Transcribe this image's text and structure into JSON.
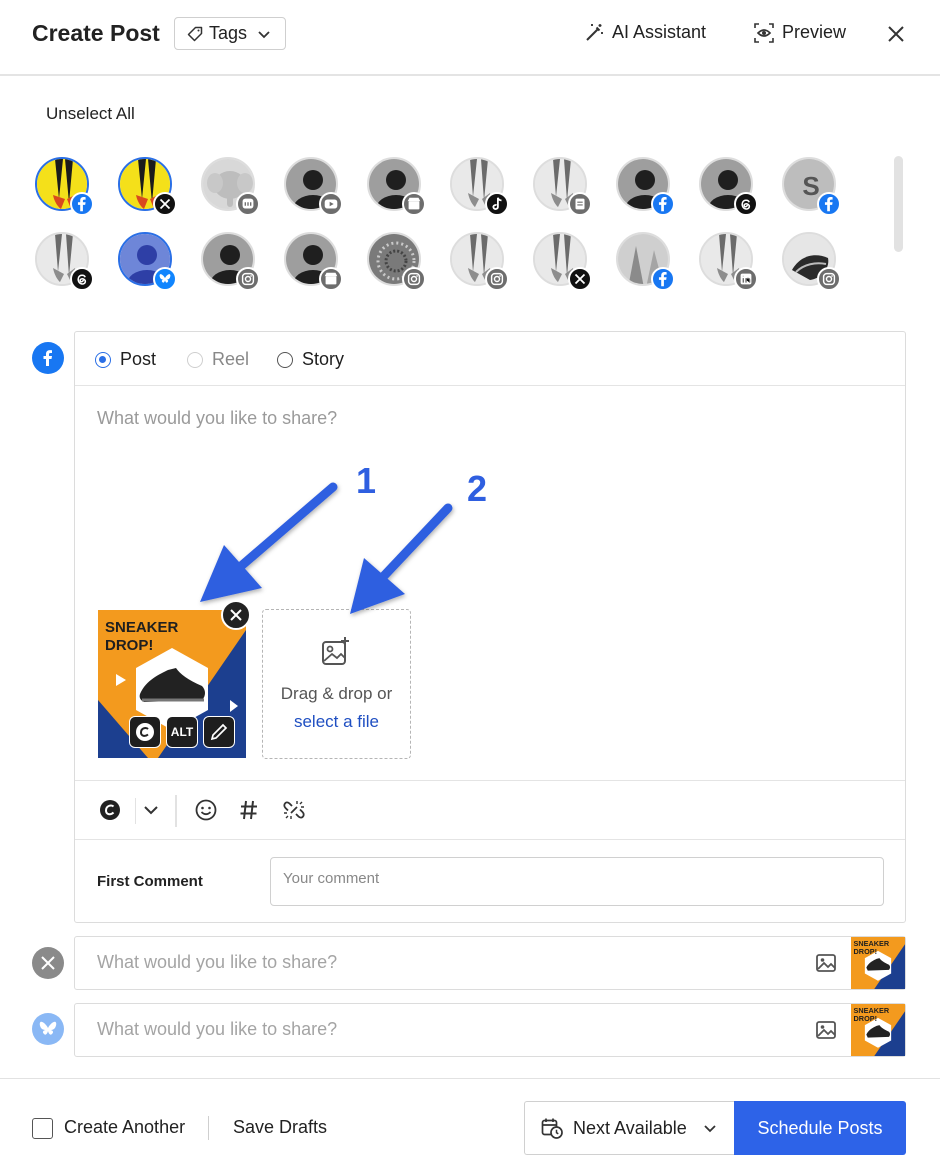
{
  "header": {
    "title": "Create Post",
    "tags_label": "Tags",
    "ai_label": "AI Assistant",
    "preview_label": "Preview"
  },
  "accounts": {
    "unselect_label": "Unselect All",
    "letter_avatar": "S",
    "items": [
      {
        "network": "facebook",
        "selected": true
      },
      {
        "network": "x",
        "selected": true
      },
      {
        "network": "mastodon",
        "selected": false
      },
      {
        "network": "youtube",
        "selected": false
      },
      {
        "network": "google-business",
        "selected": false
      },
      {
        "network": "tiktok",
        "selected": false
      },
      {
        "network": "other",
        "selected": false
      },
      {
        "network": "facebook",
        "selected": false
      },
      {
        "network": "threads",
        "selected": false
      },
      {
        "network": "facebook",
        "selected": false
      },
      {
        "network": "threads",
        "selected": false
      },
      {
        "network": "bluesky",
        "selected": true
      },
      {
        "network": "instagram",
        "selected": false
      },
      {
        "network": "google-business",
        "selected": false
      },
      {
        "network": "instagram",
        "selected": false
      },
      {
        "network": "instagram",
        "selected": false
      },
      {
        "network": "x",
        "selected": false
      },
      {
        "network": "facebook",
        "selected": false
      },
      {
        "network": "linkedin",
        "selected": false
      },
      {
        "network": "instagram",
        "selected": false
      }
    ]
  },
  "composer": {
    "types": [
      {
        "label": "Post",
        "checked": true
      },
      {
        "label": "Reel",
        "checked": false
      },
      {
        "label": "Story",
        "checked": false
      }
    ],
    "placeholder": "What would you like to share?",
    "media_text": "SNEAKER DROP!",
    "alt_label": "ALT",
    "drop_text": "Drag & drop or",
    "drop_link": "select a file",
    "first_comment_label": "First Comment",
    "comment_placeholder": "Your comment"
  },
  "annotations": {
    "arrow1": "1",
    "arrow2": "2"
  },
  "networks": [
    {
      "name": "x",
      "placeholder": "What would you like to share?"
    },
    {
      "name": "bluesky",
      "placeholder": "What would you like to share?"
    }
  ],
  "footer": {
    "create_another": "Create Another",
    "save_drafts": "Save Drafts",
    "next_available": "Next Available",
    "schedule": "Schedule Posts"
  },
  "colors": {
    "accent": "#2d63e8",
    "facebook": "#1877f2",
    "bluesky": "#1185fe",
    "brand_orange": "#f39a1e",
    "brand_navy": "#1c3f8f"
  }
}
